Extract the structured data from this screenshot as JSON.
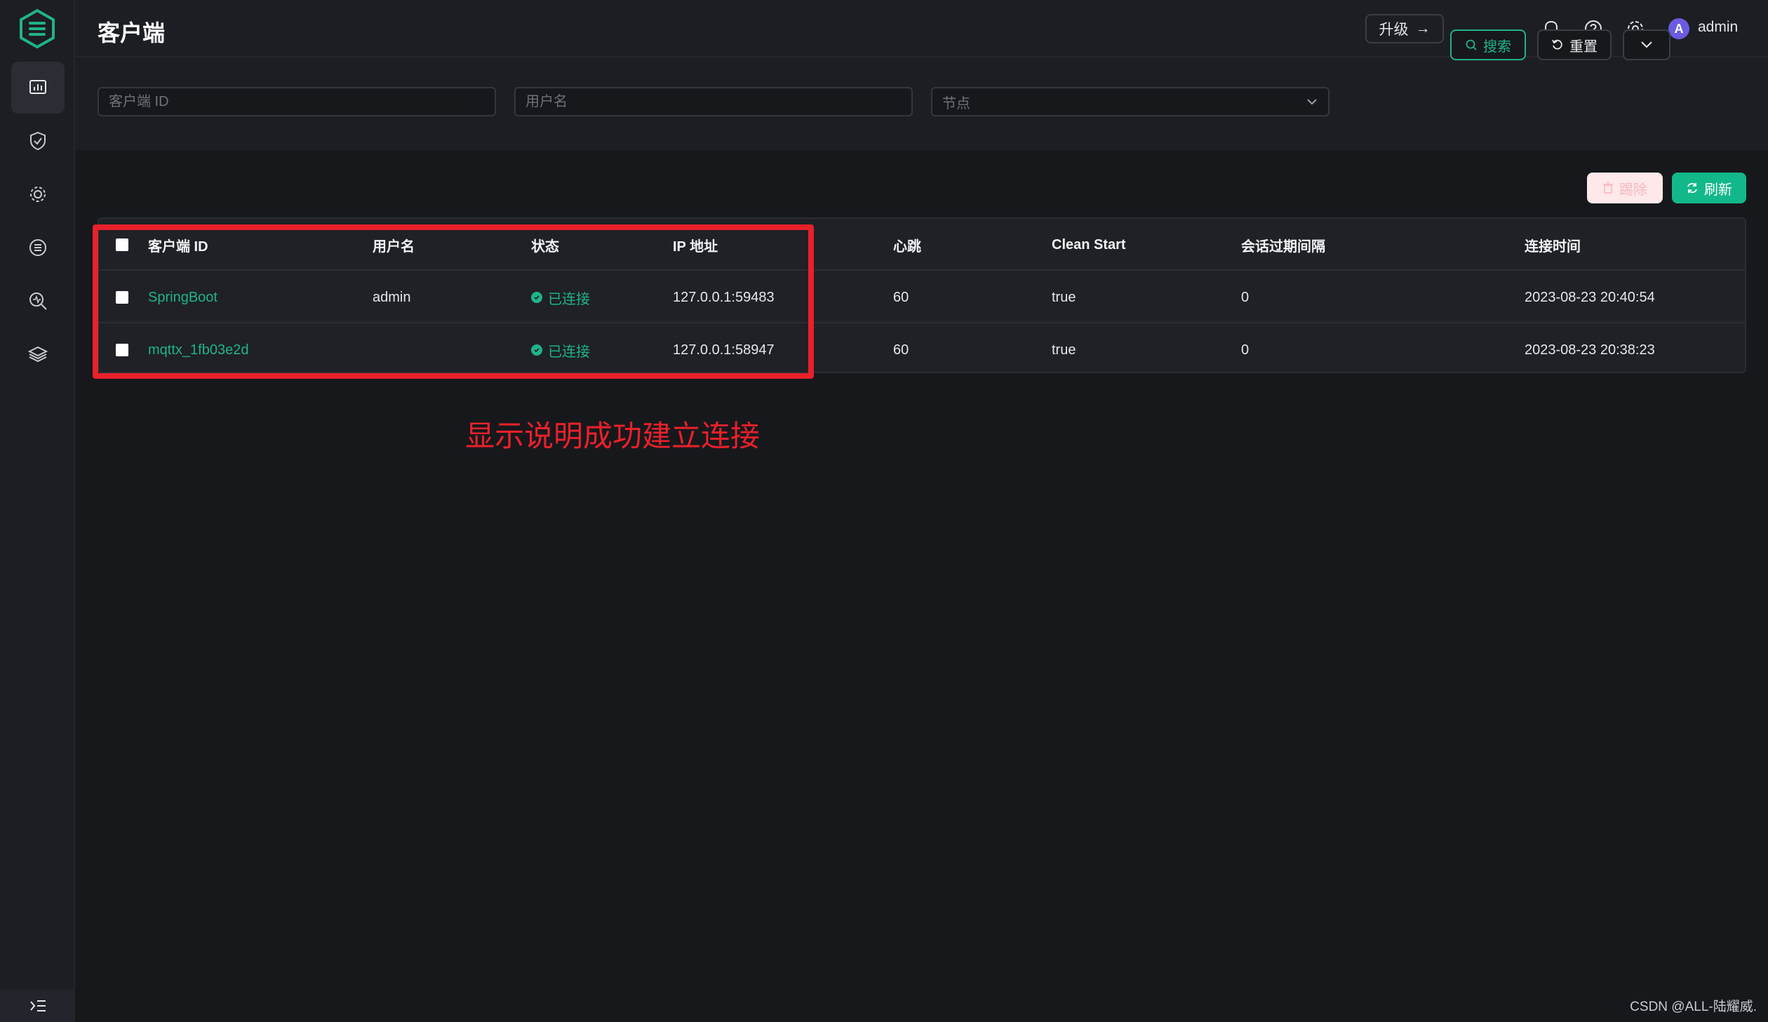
{
  "header": {
    "title": "客户端",
    "upgrade_label": "升级",
    "user": {
      "avatar_letter": "A",
      "name": "admin"
    }
  },
  "filters": {
    "client_id_placeholder": "客户端 ID",
    "username_placeholder": "用户名",
    "node_placeholder": "节点",
    "search_label": "搜索",
    "reset_label": "重置"
  },
  "actions": {
    "delete_label": "踢除",
    "refresh_label": "刷新"
  },
  "table": {
    "columns": [
      "客户端 ID",
      "用户名",
      "状态",
      "IP 地址",
      "心跳",
      "Clean Start",
      "会话过期间隔",
      "连接时间"
    ],
    "rows": [
      {
        "client_id": "SpringBoot",
        "username": "admin",
        "status": "已连接",
        "ip": "127.0.0.1:59483",
        "keepalive": "60",
        "clean_start": "true",
        "expiry": "0",
        "connected_at": "2023-08-23 20:40:54"
      },
      {
        "client_id": "mqttx_1fb03e2d",
        "username": "",
        "status": "已连接",
        "ip": "127.0.0.1:58947",
        "keepalive": "60",
        "clean_start": "true",
        "expiry": "0",
        "connected_at": "2023-08-23 20:38:23"
      }
    ]
  },
  "annotation": {
    "text": "显示说明成功建立连接"
  },
  "watermark": "CSDN @ALL-陆耀威.",
  "colors": {
    "accent": "#20b38a",
    "annotation": "#e8212a",
    "avatar": "#6a5be0"
  }
}
